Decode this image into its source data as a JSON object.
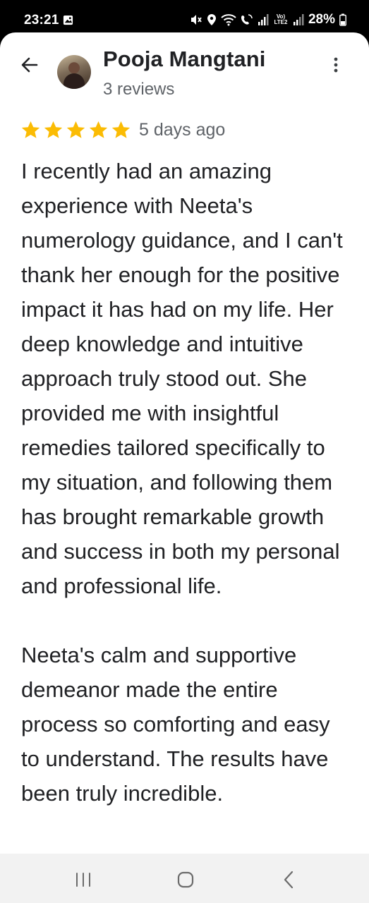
{
  "status_bar": {
    "time": "23:21",
    "lte_label": "Vo) LTE2",
    "battery": "28%"
  },
  "header": {
    "reviewer_name": "Pooja Mangtani",
    "review_count": "3 reviews"
  },
  "review": {
    "rating": 5,
    "max_rating": 5,
    "star_color": "#fbbc04",
    "date": "5 days ago",
    "paragraphs": [
      "I recently had an amazing experience with Neeta's numerology guidance, and I can't thank her enough for the positive impact it has had on my life. Her deep knowledge and intuitive approach truly stood out. She provided me with insightful remedies tailored specifically to my situation, and following them has brought remarkable growth and success in both my personal and professional life.",
      "Neeta's calm and supportive demeanor made the entire process so comforting and easy to understand. The results have been truly incredible."
    ]
  },
  "icons": {
    "back": "arrow-left-icon",
    "more": "more-vert-icon",
    "nav_recent": "recent-apps-icon",
    "nav_home": "home-icon",
    "nav_back": "chevron-left-icon"
  }
}
